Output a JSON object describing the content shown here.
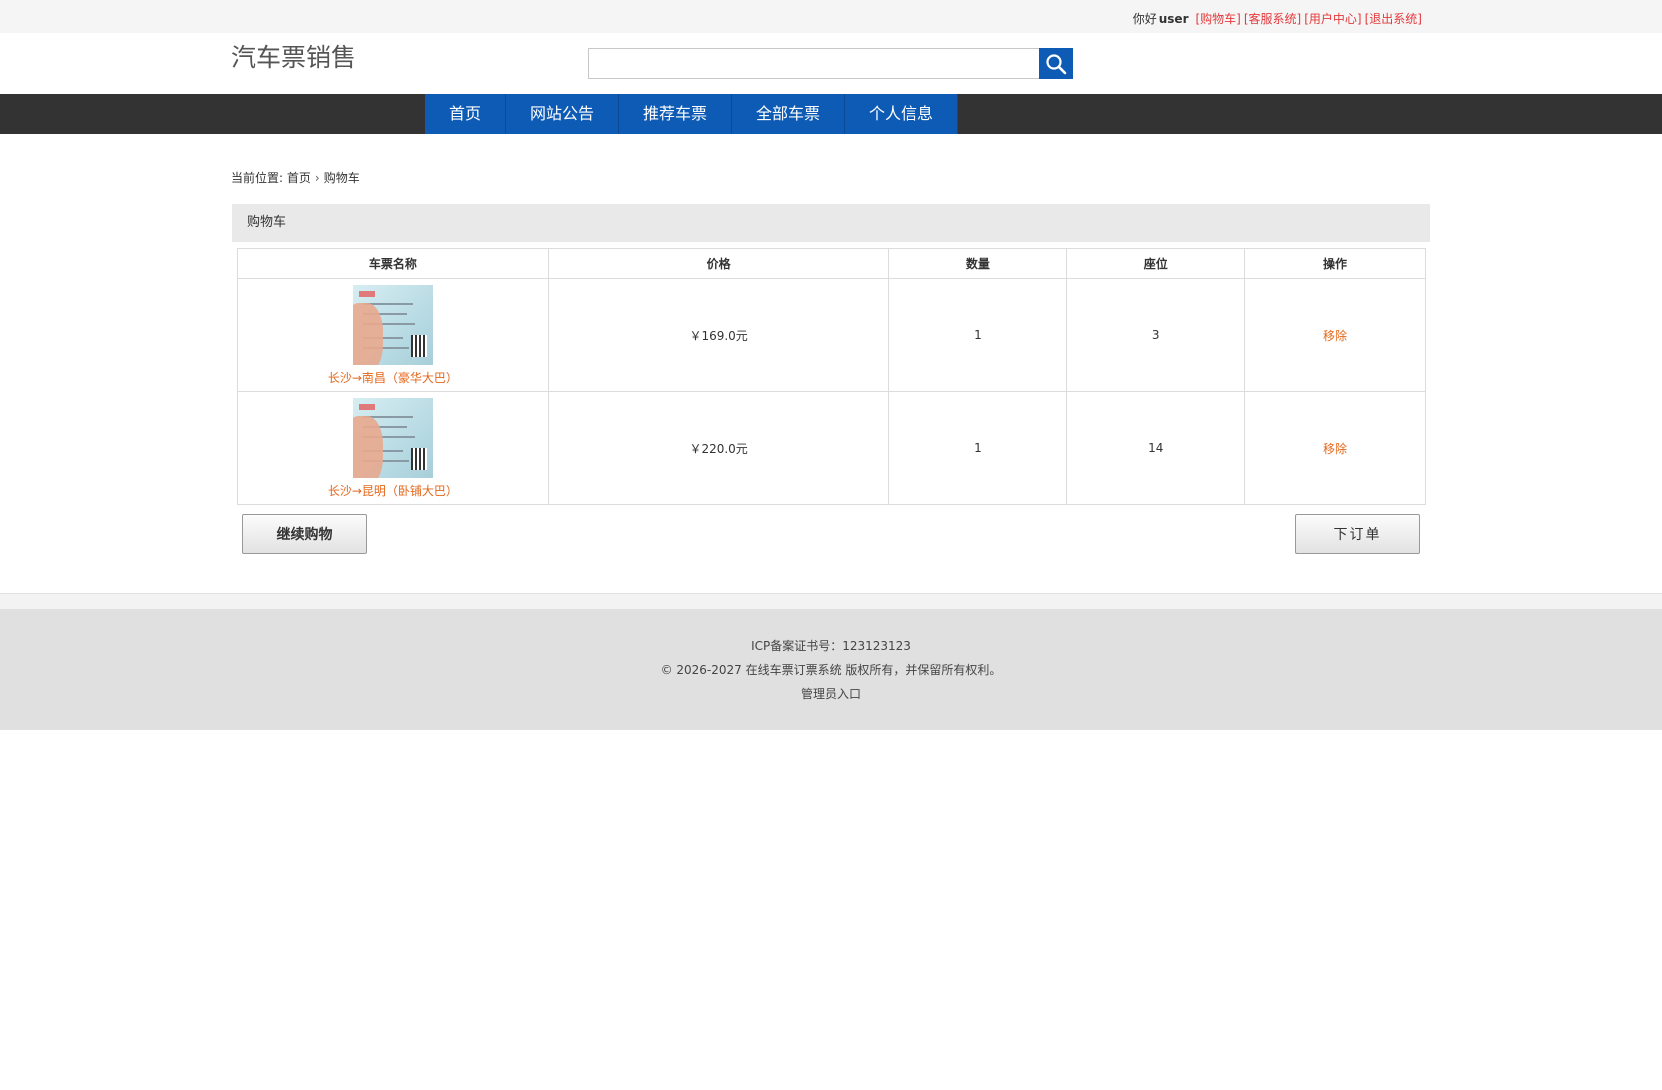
{
  "topbar": {
    "greeting": "你好",
    "username": "user",
    "links": [
      "[购物车]",
      "[客服系统]",
      "[用户中心]",
      "[退出系统]"
    ]
  },
  "header": {
    "logo": "汽车票销售",
    "search_value": "",
    "search_icon": "search-icon"
  },
  "nav": [
    "首页",
    "网站公告",
    "推荐车票",
    "全部车票",
    "个人信息"
  ],
  "breadcrumb": {
    "prefix": "当前位置:",
    "home": "首页",
    "current": "购物车"
  },
  "panel_title": "购物车",
  "table": {
    "headers": [
      "车票名称",
      "价格",
      "数量",
      "座位",
      "操作"
    ],
    "rows": [
      {
        "name": "长沙→南昌（豪华大巴）",
        "price": "￥169.0元",
        "qty": "1",
        "seat": "3",
        "action": "移除"
      },
      {
        "name": "长沙→昆明（卧铺大巴）",
        "price": "￥220.0元",
        "qty": "1",
        "seat": "14",
        "action": "移除"
      }
    ]
  },
  "buttons": {
    "continue": "继续购物",
    "order": "下订单"
  },
  "footer": {
    "icp": "ICP备案证书号：123123123",
    "copyright": "© 2026-2027 在线车票订票系统 版权所有，并保留所有权利。",
    "admin": "管理员入口"
  }
}
